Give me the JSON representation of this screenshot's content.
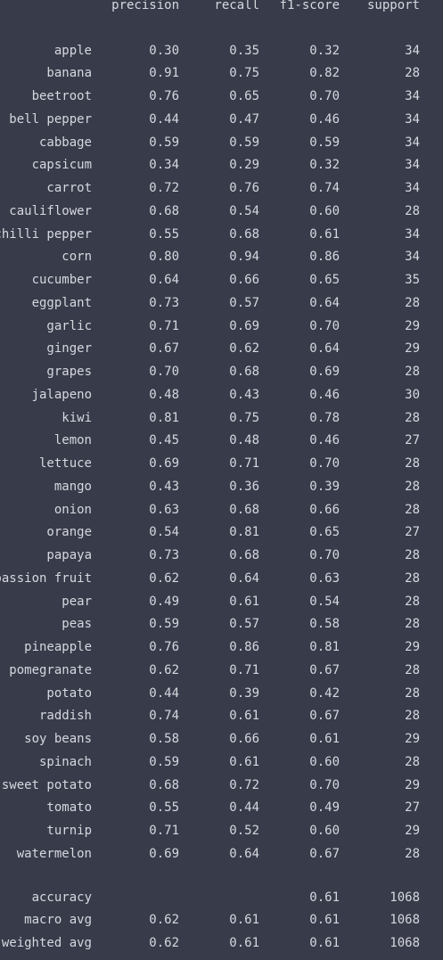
{
  "headers": {
    "precision": "precision",
    "recall": "recall",
    "f1": "f1-score",
    "support": "support"
  },
  "rows": [
    {
      "label": "apple",
      "precision": "0.30",
      "recall": "0.35",
      "f1": "0.32",
      "support": "34"
    },
    {
      "label": "banana",
      "precision": "0.91",
      "recall": "0.75",
      "f1": "0.82",
      "support": "28"
    },
    {
      "label": "beetroot",
      "precision": "0.76",
      "recall": "0.65",
      "f1": "0.70",
      "support": "34"
    },
    {
      "label": "bell pepper",
      "precision": "0.44",
      "recall": "0.47",
      "f1": "0.46",
      "support": "34"
    },
    {
      "label": "cabbage",
      "precision": "0.59",
      "recall": "0.59",
      "f1": "0.59",
      "support": "34"
    },
    {
      "label": "capsicum",
      "precision": "0.34",
      "recall": "0.29",
      "f1": "0.32",
      "support": "34"
    },
    {
      "label": "carrot",
      "precision": "0.72",
      "recall": "0.76",
      "f1": "0.74",
      "support": "34"
    },
    {
      "label": "cauliflower",
      "precision": "0.68",
      "recall": "0.54",
      "f1": "0.60",
      "support": "28"
    },
    {
      "label": "chilli pepper",
      "precision": "0.55",
      "recall": "0.68",
      "f1": "0.61",
      "support": "34"
    },
    {
      "label": "corn",
      "precision": "0.80",
      "recall": "0.94",
      "f1": "0.86",
      "support": "34"
    },
    {
      "label": "cucumber",
      "precision": "0.64",
      "recall": "0.66",
      "f1": "0.65",
      "support": "35"
    },
    {
      "label": "eggplant",
      "precision": "0.73",
      "recall": "0.57",
      "f1": "0.64",
      "support": "28"
    },
    {
      "label": "garlic",
      "precision": "0.71",
      "recall": "0.69",
      "f1": "0.70",
      "support": "29"
    },
    {
      "label": "ginger",
      "precision": "0.67",
      "recall": "0.62",
      "f1": "0.64",
      "support": "29"
    },
    {
      "label": "grapes",
      "precision": "0.70",
      "recall": "0.68",
      "f1": "0.69",
      "support": "28"
    },
    {
      "label": "jalapeno",
      "precision": "0.48",
      "recall": "0.43",
      "f1": "0.46",
      "support": "30"
    },
    {
      "label": "kiwi",
      "precision": "0.81",
      "recall": "0.75",
      "f1": "0.78",
      "support": "28"
    },
    {
      "label": "lemon",
      "precision": "0.45",
      "recall": "0.48",
      "f1": "0.46",
      "support": "27"
    },
    {
      "label": "lettuce",
      "precision": "0.69",
      "recall": "0.71",
      "f1": "0.70",
      "support": "28"
    },
    {
      "label": "mango",
      "precision": "0.43",
      "recall": "0.36",
      "f1": "0.39",
      "support": "28"
    },
    {
      "label": "onion",
      "precision": "0.63",
      "recall": "0.68",
      "f1": "0.66",
      "support": "28"
    },
    {
      "label": "orange",
      "precision": "0.54",
      "recall": "0.81",
      "f1": "0.65",
      "support": "27"
    },
    {
      "label": "papaya",
      "precision": "0.73",
      "recall": "0.68",
      "f1": "0.70",
      "support": "28"
    },
    {
      "label": "passion fruit",
      "precision": "0.62",
      "recall": "0.64",
      "f1": "0.63",
      "support": "28"
    },
    {
      "label": "pear",
      "precision": "0.49",
      "recall": "0.61",
      "f1": "0.54",
      "support": "28"
    },
    {
      "label": "peas",
      "precision": "0.59",
      "recall": "0.57",
      "f1": "0.58",
      "support": "28"
    },
    {
      "label": "pineapple",
      "precision": "0.76",
      "recall": "0.86",
      "f1": "0.81",
      "support": "29"
    },
    {
      "label": "pomegranate",
      "precision": "0.62",
      "recall": "0.71",
      "f1": "0.67",
      "support": "28"
    },
    {
      "label": "potato",
      "precision": "0.44",
      "recall": "0.39",
      "f1": "0.42",
      "support": "28"
    },
    {
      "label": "raddish",
      "precision": "0.74",
      "recall": "0.61",
      "f1": "0.67",
      "support": "28"
    },
    {
      "label": "soy beans",
      "precision": "0.58",
      "recall": "0.66",
      "f1": "0.61",
      "support": "29"
    },
    {
      "label": "spinach",
      "precision": "0.59",
      "recall": "0.61",
      "f1": "0.60",
      "support": "28"
    },
    {
      "label": "sweet potato",
      "precision": "0.68",
      "recall": "0.72",
      "f1": "0.70",
      "support": "29"
    },
    {
      "label": "tomato",
      "precision": "0.55",
      "recall": "0.44",
      "f1": "0.49",
      "support": "27"
    },
    {
      "label": "turnip",
      "precision": "0.71",
      "recall": "0.52",
      "f1": "0.60",
      "support": "29"
    },
    {
      "label": "watermelon",
      "precision": "0.69",
      "recall": "0.64",
      "f1": "0.67",
      "support": "28"
    }
  ],
  "summary": [
    {
      "label": "accuracy",
      "precision": "",
      "recall": "",
      "f1": "0.61",
      "support": "1068"
    },
    {
      "label": "macro avg",
      "precision": "0.62",
      "recall": "0.61",
      "f1": "0.61",
      "support": "1068"
    },
    {
      "label": "weighted avg",
      "precision": "0.62",
      "recall": "0.61",
      "f1": "0.61",
      "support": "1068"
    }
  ],
  "colors": {
    "background": "#383b4a",
    "text": "#d6d8df"
  }
}
